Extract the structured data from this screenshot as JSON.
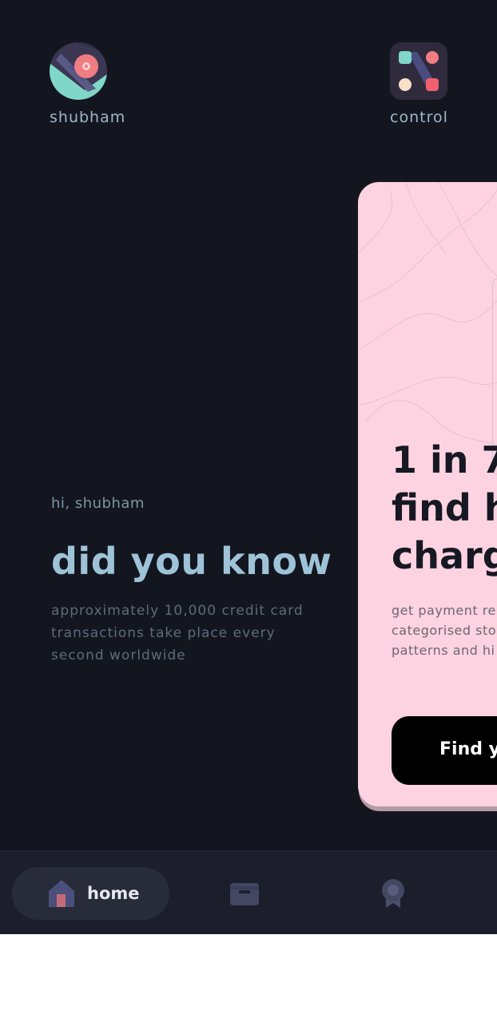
{
  "header": {
    "profile_label": "shubham",
    "control_label": "control"
  },
  "intro": {
    "greeting": "hi, shubham",
    "headline": "did you know",
    "fact": "approximately 10,000 credit card transactions take place every second worldwide"
  },
  "promo_card": {
    "title_lines": [
      "1 in 7",
      "find h",
      "charg"
    ],
    "description_lines": [
      "get payment re",
      "categorised sto",
      "patterns and hi"
    ],
    "button_label": "Find yo"
  },
  "nav": {
    "home_label": "home",
    "items": [
      "home-icon",
      "wallet-icon",
      "reward-icon"
    ]
  },
  "colors": {
    "background": "#13161f",
    "card": "#fdd3e1",
    "headline": "#9ec3d8",
    "nav": "#1c1f2b"
  }
}
